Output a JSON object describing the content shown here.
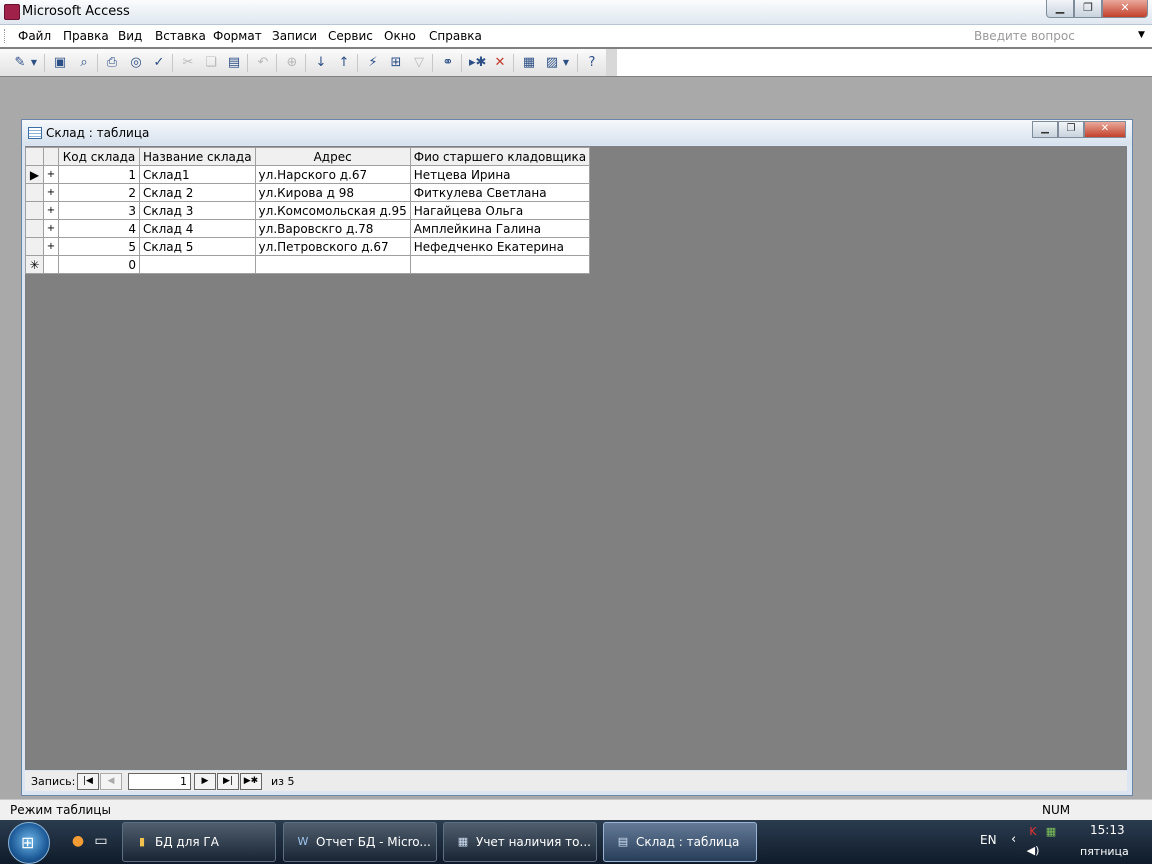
{
  "app": {
    "title": "Microsoft Access"
  },
  "menu": {
    "items": [
      "Файл",
      "Правка",
      "Вид",
      "Вставка",
      "Формат",
      "Записи",
      "Сервис",
      "Окно",
      "Справка"
    ],
    "ask_placeholder": "Введите вопрос"
  },
  "toolbar": {
    "icons": [
      "design-view-icon",
      "save-icon",
      "search-files-icon",
      "print-icon",
      "print-preview-icon",
      "spelling-icon",
      "cut-icon",
      "copy-icon",
      "paste-icon",
      "undo-icon",
      "hyperlink-icon",
      "sort-ascending-icon",
      "sort-descending-icon",
      "filter-by-selection-icon",
      "filter-by-form-icon",
      "apply-filter-icon",
      "find-icon",
      "new-record-icon",
      "delete-record-icon",
      "database-window-icon",
      "new-object-icon",
      "help-icon"
    ]
  },
  "child_window": {
    "title": "Склад : таблица",
    "columns": [
      "Код склада",
      "Название склада",
      "Адрес",
      "Фио старшего  кладовщика"
    ],
    "rows": [
      {
        "id": "1",
        "name": "Склад1",
        "address": "ул.Нарского д.67",
        "manager": "Нетцева Ирина"
      },
      {
        "id": "2",
        "name": "Склад 2",
        "address": "ул.Кирова д 98",
        "manager": "Фиткулева Светлана"
      },
      {
        "id": "3",
        "name": "Склад 3",
        "address": "ул.Комсомольская д.95",
        "manager": "Нагайцева Ольга"
      },
      {
        "id": "4",
        "name": "Склад 4",
        "address": "ул.Варовскго д.78",
        "manager": "Амплейкина Галина"
      },
      {
        "id": "5",
        "name": "Склад 5",
        "address": "ул.Петровского д.67",
        "manager": "Нефедченко Екатерина"
      }
    ],
    "new_row_default": "0",
    "expand_symbol": "+",
    "new_record_symbol": "✳",
    "navigator": {
      "label": "Запись:",
      "current": "1",
      "of_label": "из  5"
    }
  },
  "statusbar": {
    "mode": "Режим таблицы",
    "num": "NUM"
  },
  "taskbar": {
    "tasks": [
      "БД для ГА",
      "Отчет БД - Micro...",
      "Учет наличия то...",
      "Склад : таблица"
    ],
    "lang": "EN",
    "time": "15:13",
    "day": "пятница"
  }
}
